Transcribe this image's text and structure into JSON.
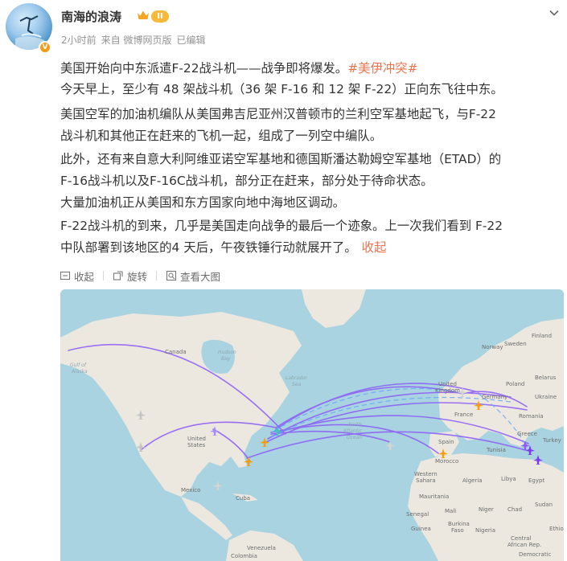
{
  "user": {
    "name": "南海的浪涛",
    "level_badge": "II",
    "verified_icon": "V"
  },
  "meta": {
    "time": "2小时前",
    "source": "来自 微博网页版",
    "edited": "已编辑"
  },
  "content": {
    "line1_text": "美国开始向中东派遣F-22战斗机——战争即将爆发。",
    "line1_tag": "#美伊冲突#",
    "line2": "今天早上，至少有 48 架战斗机（36 架 F-16 和 12 架 F-22）正向东飞往中东。",
    "line3": "美国空军的加油机编队从美国弗吉尼亚州汉普顿市的兰利空军基地起飞，与F-22",
    "line4": "战斗机和其他正在赶来的飞机一起，组成了一列空中编队。",
    "line5": "此外，还有来自意大利阿维亚诺空军基地和德国斯潘达勒姆空军基地（ETAD）的",
    "line6": "F-16战斗机以及F-16C战斗机，部分正在赶来，部分处于待命状态。",
    "line7": "大量加油机正从美国和东方国家向地中海地区调动。",
    "line8": "F-22战斗机的到来，几乎是美国走向战争的最后一个迹象。上一次我们看到 F-22",
    "line9": "中队部署到该地区的4 天后，午夜铁锤行动就展开了。",
    "collapse": "收起"
  },
  "actions": {
    "collapse": "收起",
    "rotate": "旋转",
    "view_large": "查看大图"
  },
  "map": {
    "labels": {
      "canada": "Canada",
      "hudson": "Hudson",
      "hudson2": "Bay",
      "gulf": "Gulf of",
      "gulf2": "Alaska",
      "labrador": "Labrador",
      "labrador2": "Sea",
      "united": "United",
      "states": "States",
      "mexico": "Mexico",
      "north": "North",
      "atlantic": "Atlantic",
      "ocean": "Ocean",
      "uk": "United",
      "kingdom": "Kingdom",
      "france": "France",
      "germany": "Germany",
      "spain": "Spain",
      "algeria": "Algeria",
      "libya": "Libya",
      "egypt": "Egypt",
      "turkey": "Turkey",
      "mali": "Mali",
      "niger": "Niger",
      "chad": "Chad",
      "nigeria": "Nigeria",
      "sudan": "Sudan",
      "ethiopia": "Ethio",
      "venezuela": "Venezuela",
      "colombia": "Colombia",
      "guinea": "Guinea",
      "burkina": "Burkina",
      "faso": "Faso",
      "congo": "Democratic",
      "cuba": "Cuba",
      "mauritania": "Mauritania",
      "morocco": "Morocco",
      "tunisia": "Tunisia",
      "greece": "Greece",
      "romania": "Romania",
      "ukraine": "Ukraine",
      "poland": "Poland",
      "belarus": "Belarus",
      "norway": "Norway",
      "sweden": "Sweden",
      "finland": "Finland",
      "central": "Central",
      "car": "African Rep.",
      "senegal": "Senegal",
      "sahara": "Western",
      "sahara2": "Sahara"
    },
    "colors": {
      "ocean": "#a9d3e1",
      "land": "#ece8df",
      "route": "#8b5cf6",
      "plane": "#f59e0b"
    }
  }
}
